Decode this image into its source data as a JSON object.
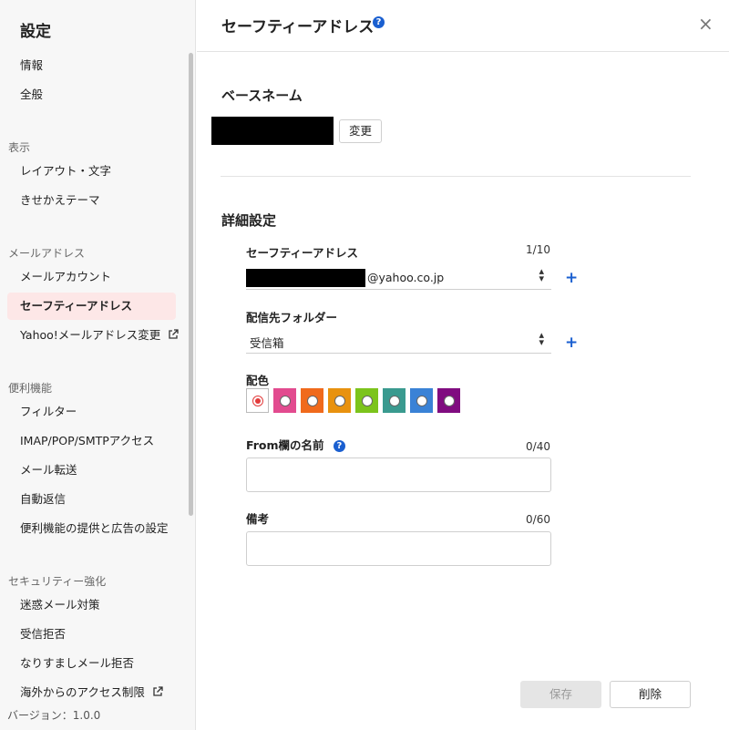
{
  "sidebar": {
    "title": "設定",
    "items": {
      "info": "情報",
      "general": "全般",
      "layout": "レイアウト・文字",
      "theme": "きせかえテーマ",
      "mail_account": "メールアカウント",
      "safety_address": "セーフティーアドレス",
      "yahoo_change": "Yahoo!メールアドレス変更",
      "filter": "フィルター",
      "imap": "IMAP/POP/SMTPアクセス",
      "forward": "メール転送",
      "auto_reply": "自動返信",
      "ads": "便利機能の提供と広告の設定",
      "spam": "迷惑メール対策",
      "block": "受信拒否",
      "spoof": "なりすましメール拒否",
      "overseas": "海外からのアクセス制限"
    },
    "sections": {
      "display": "表示",
      "mail_address": "メールアドレス",
      "convenience": "便利機能",
      "security": "セキュリティー強化"
    },
    "version": "バージョン：1.0.0"
  },
  "header": {
    "title": "セーフティーアドレス",
    "help_icon": "?",
    "close_icon": "×"
  },
  "base_name": {
    "heading": "ベースネーム",
    "change_label": "変更"
  },
  "details": {
    "heading": "詳細設定",
    "address_label": "セーフティーアドレス",
    "address_count": "1/10",
    "address_domain": "@yahoo.co.jp",
    "folder_label": "配信先フォルダー",
    "folder_value": "受信箱",
    "color_label": "配色",
    "colors": [
      "#ffffff",
      "#e24b8f",
      "#f06a1c",
      "#e8920f",
      "#7cc41c",
      "#3a9a8f",
      "#3a82d6",
      "#800c80"
    ],
    "from_label": "From欄の名前",
    "from_count": "0/40",
    "note_label": "備考",
    "note_count": "0/60",
    "plus": "+",
    "arrows": "⌃⌄"
  },
  "footer": {
    "save_label": "保存",
    "delete_label": "削除"
  }
}
